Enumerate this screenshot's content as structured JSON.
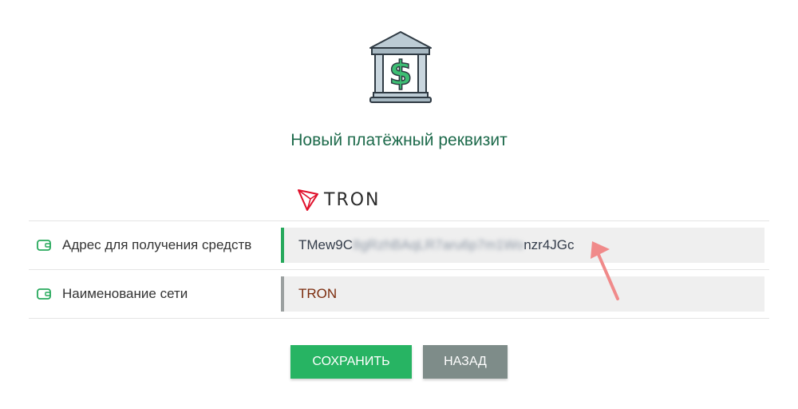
{
  "page": {
    "title": "Новый платёжный реквизит"
  },
  "brand": {
    "name": "TRON",
    "accent": "#e0102b"
  },
  "form": {
    "rows": [
      {
        "label": "Адрес для получения средств",
        "icon": "wallet-icon",
        "value_prefix": "TMew9C",
        "value_hidden": "8gRzhBAqLR7aru6p7m1Wo",
        "value_suffix": "nzr4JGc"
      },
      {
        "label": "Наименование сети",
        "icon": "wallet-icon",
        "value": "TRON"
      }
    ]
  },
  "actions": {
    "save_label": "Сохранить",
    "back_label": "Назад"
  },
  "colors": {
    "title": "#1d6a4b",
    "save_button": "#27b463",
    "back_button": "#7e8c89",
    "active_field_border": "#27a95c",
    "network_value": "#7b2b0c",
    "annotation_arrow": "#f08a8a"
  }
}
